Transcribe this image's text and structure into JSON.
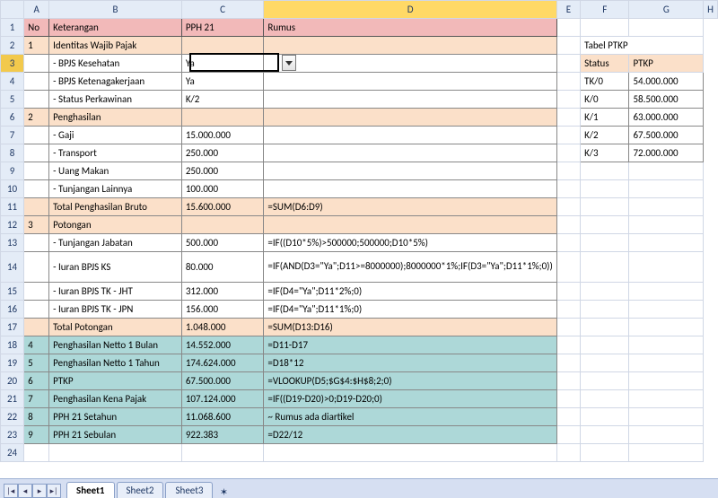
{
  "columns": [
    "A",
    "B",
    "C",
    "D",
    "E",
    "F",
    "G",
    "H"
  ],
  "headers": {
    "no": "No",
    "ket": "Keterangan",
    "pph": "PPH 21",
    "rumus": "Rumus"
  },
  "sections": {
    "s1": {
      "no": "1",
      "title": "Identitas Wajib Pajak"
    },
    "s2": {
      "no": "2",
      "title": "Penghasilan"
    },
    "s3": {
      "no": "3",
      "title": "Potongan"
    }
  },
  "identitas": {
    "r3": {
      "label": "- BPJS Kesehatan",
      "val": "Ya"
    },
    "r4": {
      "label": "- BPJS Ketenagakerjaan",
      "val": "Ya"
    },
    "r5": {
      "label": "- Status Perkawinan",
      "val": "K/2"
    }
  },
  "penghasilan": {
    "r7": {
      "label": "- Gaji",
      "val": "15.000.000"
    },
    "r8": {
      "label": "- Transport",
      "val": "250.000"
    },
    "r9": {
      "label": "- Uang Makan",
      "val": "250.000"
    },
    "r10": {
      "label": "- Tunjangan Lainnya",
      "val": "100.000"
    },
    "total": {
      "label": "Total Penghasilan Bruto",
      "val": "15.600.000",
      "formula": "=SUM(D6:D9)"
    }
  },
  "potongan": {
    "r13": {
      "label": "- Tunjangan Jabatan",
      "val": "500.000",
      "formula": "=IF((D10*5%)>500000;500000;D10*5%)"
    },
    "r14": {
      "label": "- Iuran BPJS KS",
      "val": "80.000",
      "formula": "=IF(AND(D3=\"Ya\";D11>=8000000);8000000*1%;IF(D3=\"Ya\";D11*1%;0))"
    },
    "r15": {
      "label": "- Iuran BPJS TK - JHT",
      "val": "312.000",
      "formula": "=IF(D4=\"Ya\";D11*2%;0)"
    },
    "r16": {
      "label": "- Iuran BPJS TK - JPN",
      "val": "156.000",
      "formula": "=IF(D4=\"Ya\";D11*1%;0)"
    },
    "total": {
      "label": "Total Potongan",
      "val": "1.048.000",
      "formula": "=SUM(D13:D16)"
    }
  },
  "summary": {
    "r18": {
      "no": "4",
      "label": "Penghasilan Netto 1 Bulan",
      "val": "14.552.000",
      "formula": "=D11-D17"
    },
    "r19": {
      "no": "5",
      "label": "Penghasilan Netto 1 Tahun",
      "val": "174.624.000",
      "formula": "=D18*12"
    },
    "r20": {
      "no": "6",
      "label": "PTKP",
      "val": "67.500.000",
      "formula": "=VLOOKUP(D5;$G$4:$H$8;2;0)"
    },
    "r21": {
      "no": "7",
      "label": "Penghasilan Kena Pajak",
      "val": "107.124.000",
      "formula": "=IF((D19-D20)>0;D19-D20;0)"
    },
    "r22": {
      "no": "8",
      "label": "PPH 21 Setahun",
      "val": "11.068.600",
      "formula": "~ Rumus ada diartikel"
    },
    "r23": {
      "no": "9",
      "label": "PPH 21 Sebulan",
      "val": "922.383",
      "formula": "=D22/12"
    }
  },
  "ptkp": {
    "title": "Tabel PTKP",
    "hdr_status": "Status",
    "hdr_ptkp": "PTKP",
    "rows": [
      {
        "status": "TK/0",
        "ptkp": "54.000.000"
      },
      {
        "status": "K/0",
        "ptkp": "58.500.000"
      },
      {
        "status": "K/1",
        "ptkp": "63.000.000"
      },
      {
        "status": "K/2",
        "ptkp": "67.500.000"
      },
      {
        "status": "K/3",
        "ptkp": "72.000.000"
      }
    ]
  },
  "tabs": {
    "s1": "Sheet1",
    "s2": "Sheet2",
    "s3": "Sheet3"
  },
  "selection": {
    "cell": "D3"
  },
  "chart_data": {
    "type": "table",
    "title": "Tabel PTKP",
    "categories": [
      "TK/0",
      "K/0",
      "K/1",
      "K/2",
      "K/3"
    ],
    "values": [
      54000000,
      58500000,
      63000000,
      67500000,
      72000000
    ],
    "xlabel": "Status",
    "ylabel": "PTKP"
  }
}
